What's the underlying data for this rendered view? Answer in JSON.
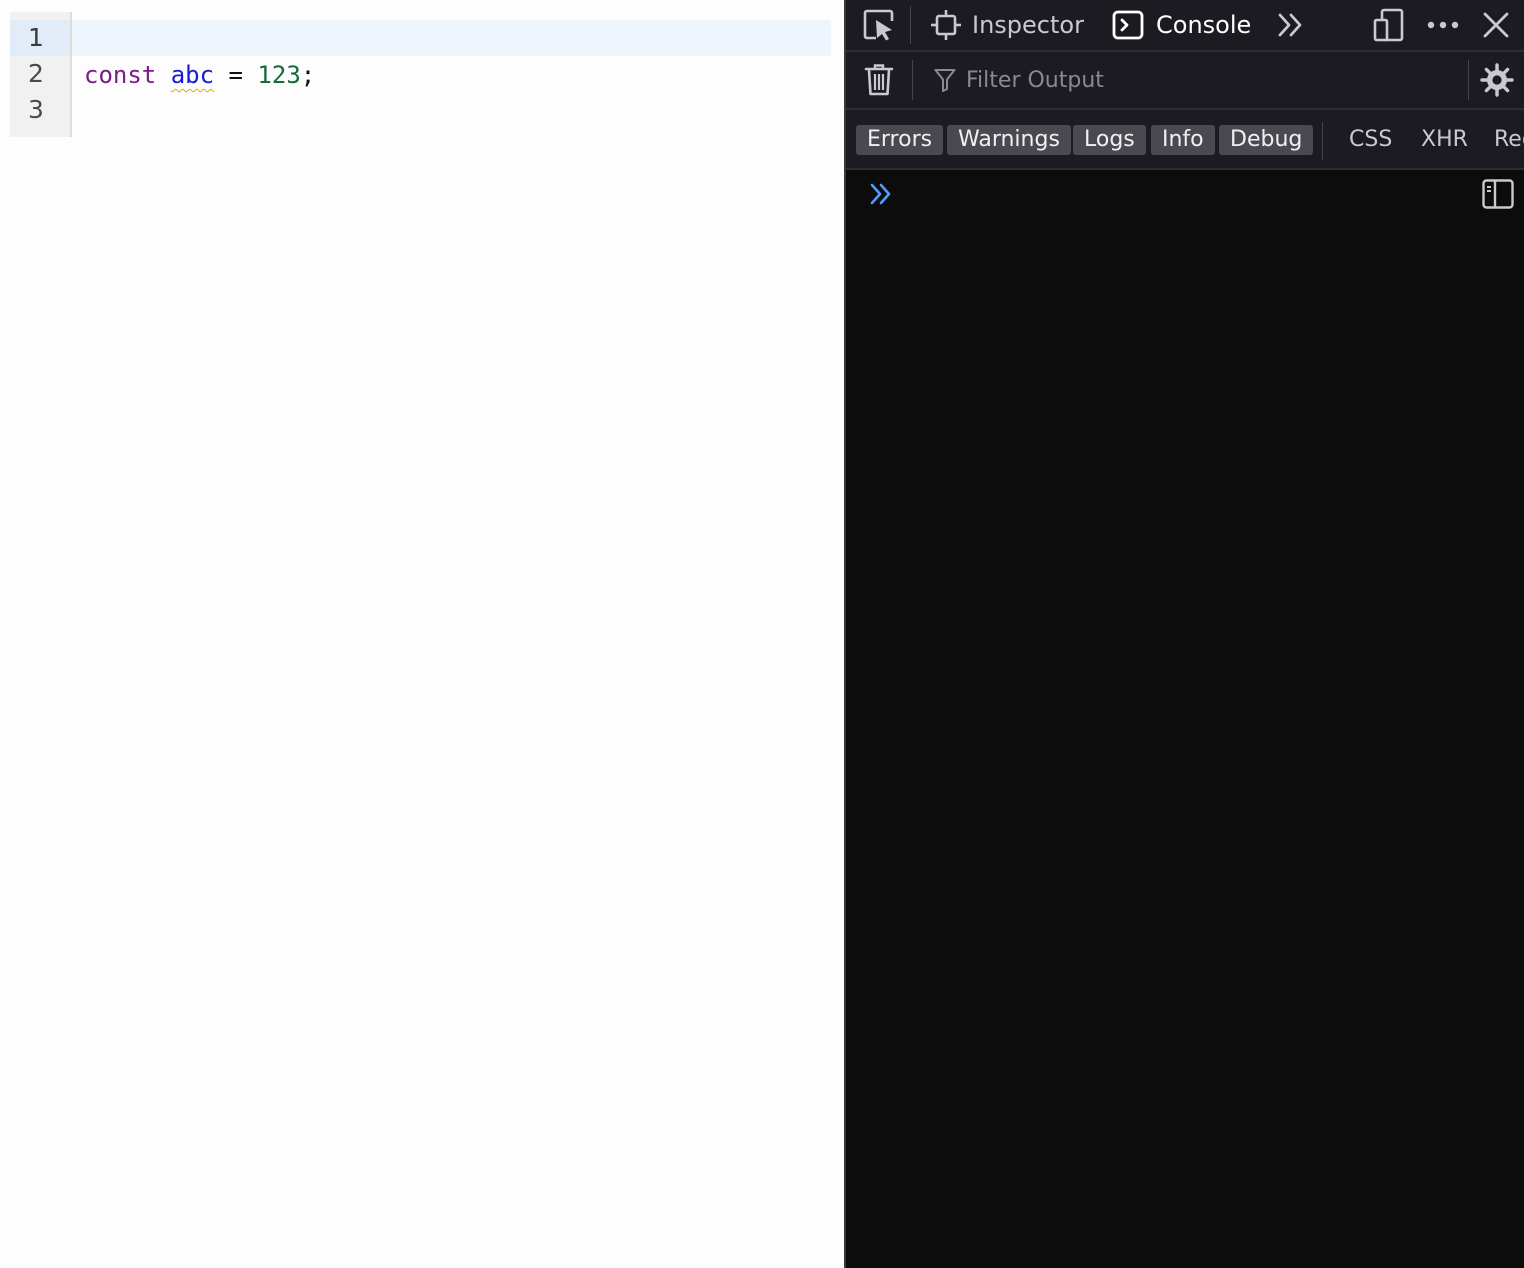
{
  "editor": {
    "line_numbers": [
      "1",
      "2",
      "3"
    ],
    "active_line": 1,
    "code": {
      "keyword": "const",
      "variable": "abc",
      "operator": "=",
      "number": "123",
      "punct": ";"
    }
  },
  "devtools": {
    "tabs": [
      {
        "label": "Inspector",
        "icon": "inspector-icon",
        "selected": false
      },
      {
        "label": "Console",
        "icon": "console-icon",
        "selected": true
      }
    ],
    "filter": {
      "placeholder": "Filter Output"
    },
    "levels": [
      {
        "label": "Errors",
        "active": true
      },
      {
        "label": "Warnings",
        "active": true
      },
      {
        "label": "Logs",
        "active": true
      },
      {
        "label": "Info",
        "active": true
      },
      {
        "label": "Debug",
        "active": true
      }
    ],
    "request_filters": [
      "CSS",
      "XHR",
      "Requests"
    ]
  },
  "colors": {
    "keyword": "#7c1b8a",
    "variable": "#1a1ad6",
    "number": "#136b3a",
    "prompt": "#4f9bff",
    "devtools_bg": "#0c0c0d",
    "toolbar_bg": "#1c1b22"
  }
}
